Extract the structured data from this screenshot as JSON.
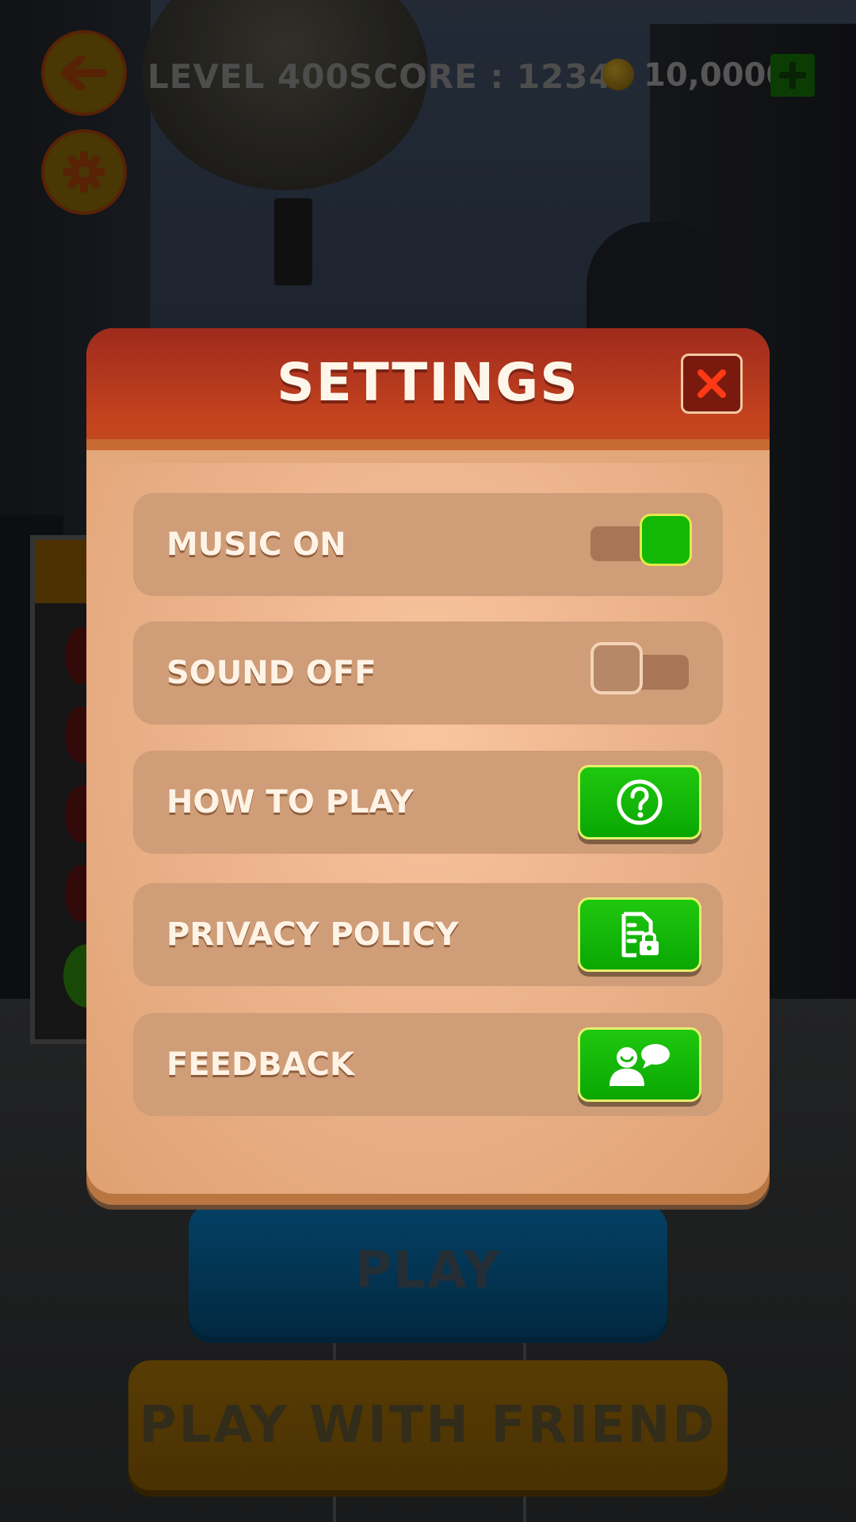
{
  "hud": {
    "level": "LEVEL 400",
    "score": "SCORE : 1234",
    "coins": "10,0000"
  },
  "settings": {
    "title": "SETTINGS",
    "rows": [
      {
        "label": "MUSIC ON",
        "control": "toggle",
        "state": "on"
      },
      {
        "label": "SOUND OFF",
        "control": "toggle",
        "state": "off"
      },
      {
        "label": "HOW TO PLAY",
        "control": "button",
        "icon": "question-icon"
      },
      {
        "label": "PRIVACY POLICY",
        "control": "button",
        "icon": "document-lock-icon"
      },
      {
        "label": "FEEDBACK",
        "control": "button",
        "icon": "chat-user-icon"
      }
    ]
  },
  "buttons": {
    "play": "PLAY",
    "play_with_friend": "PLAY WITH FRIEND"
  },
  "colors": {
    "modal_header": "#c4431f",
    "modal_body": "#eab088",
    "toggle_on": "#13b806",
    "action_button": "#13c208"
  }
}
